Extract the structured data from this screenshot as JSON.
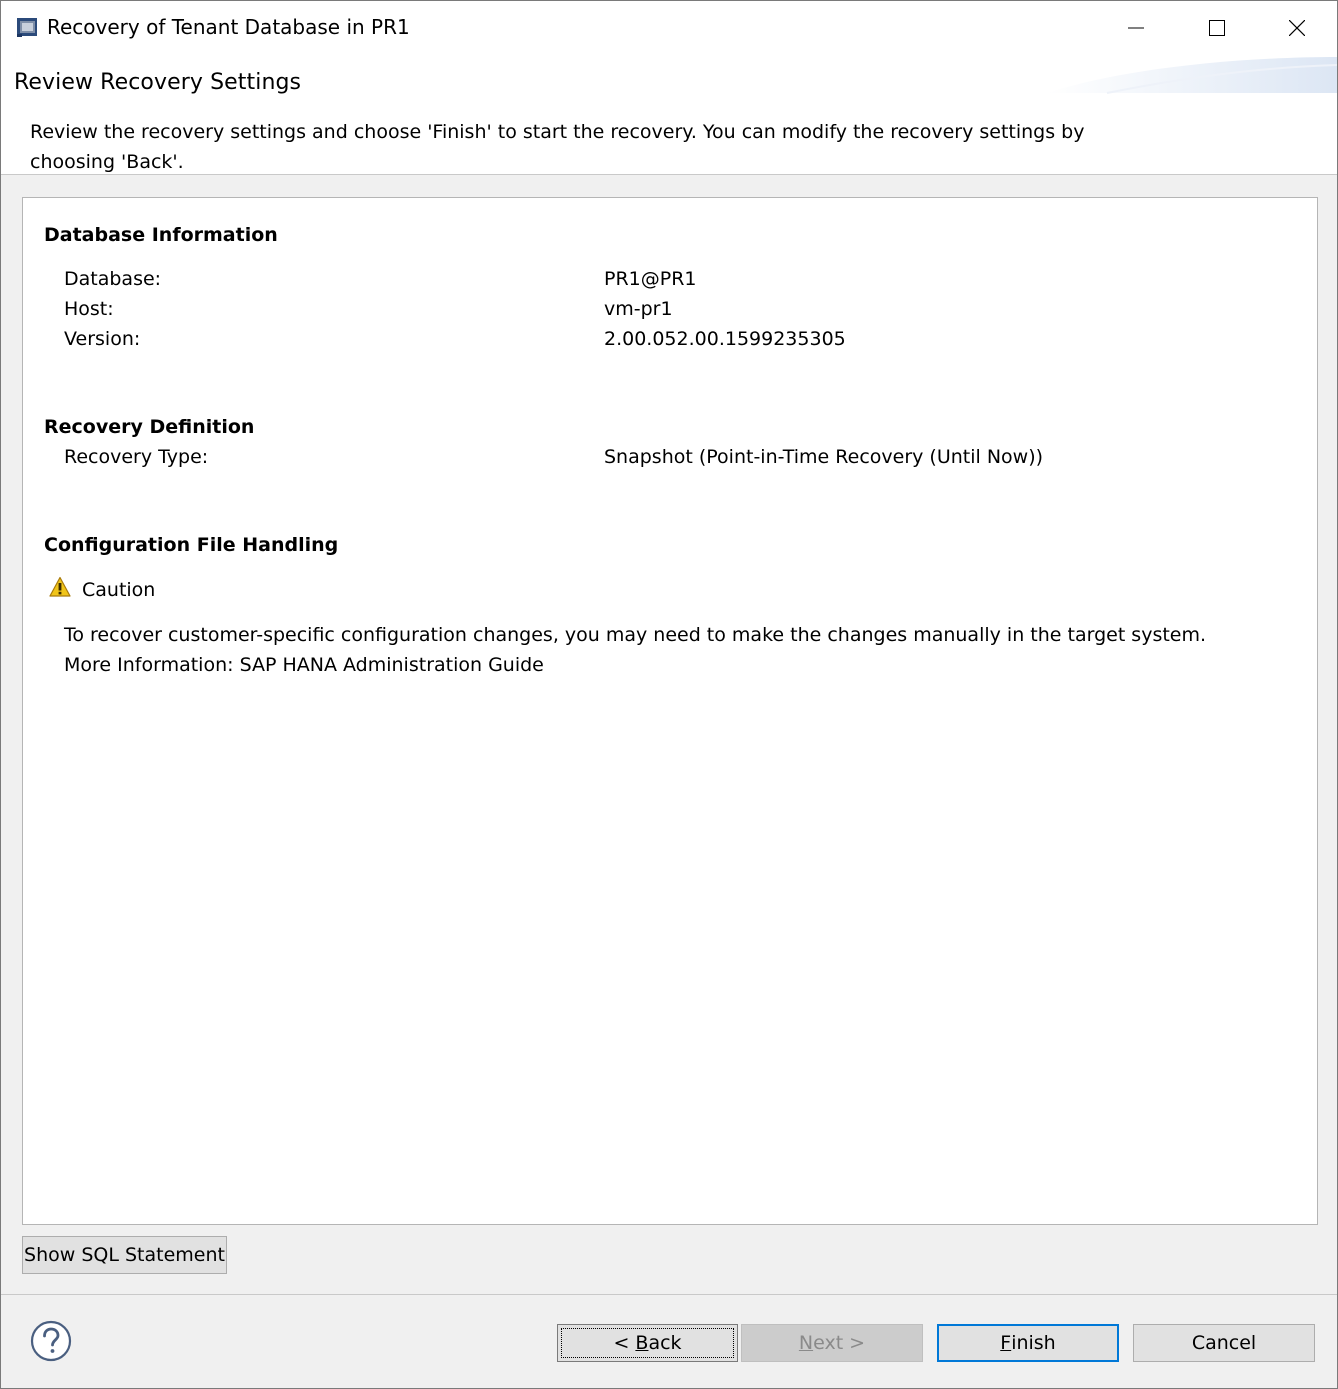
{
  "window": {
    "title": "Recovery of Tenant Database in PR1"
  },
  "header": {
    "title": "Review Recovery Settings",
    "description": "Review the recovery settings and choose 'Finish' to start the recovery. You can modify the recovery settings by choosing 'Back'."
  },
  "database_information": {
    "heading": "Database Information",
    "rows": [
      {
        "label": "Database:",
        "value": "PR1@PR1"
      },
      {
        "label": "Host:",
        "value": "vm-pr1"
      },
      {
        "label": "Version:",
        "value": "2.00.052.00.1599235305"
      }
    ]
  },
  "recovery_definition": {
    "heading": "Recovery Definition",
    "rows": [
      {
        "label": "Recovery Type:",
        "value": "Snapshot (Point-in-Time Recovery (Until Now))"
      }
    ]
  },
  "configuration_file_handling": {
    "heading": "Configuration File Handling",
    "caution_label": "Caution",
    "note_line1": "To recover customer-specific configuration changes, you may need to make the changes manually in the target system.",
    "note_line2": "More Information: SAP HANA Administration Guide"
  },
  "buttons": {
    "show_sql": "Show SQL Statement",
    "back_prefix": "< ",
    "back_mnemonic": "B",
    "back_rest": "ack",
    "next": "Next >",
    "finish_mnemonic": "F",
    "finish_rest": "inish",
    "cancel": "Cancel"
  },
  "icons": {
    "app": "app-window-icon",
    "minimize": "minimize-icon",
    "maximize": "maximize-icon",
    "close": "close-icon",
    "caution": "warning-icon",
    "help": "help-icon"
  },
  "colors": {
    "accent": "#0078d7",
    "caution": "#f0c419"
  }
}
